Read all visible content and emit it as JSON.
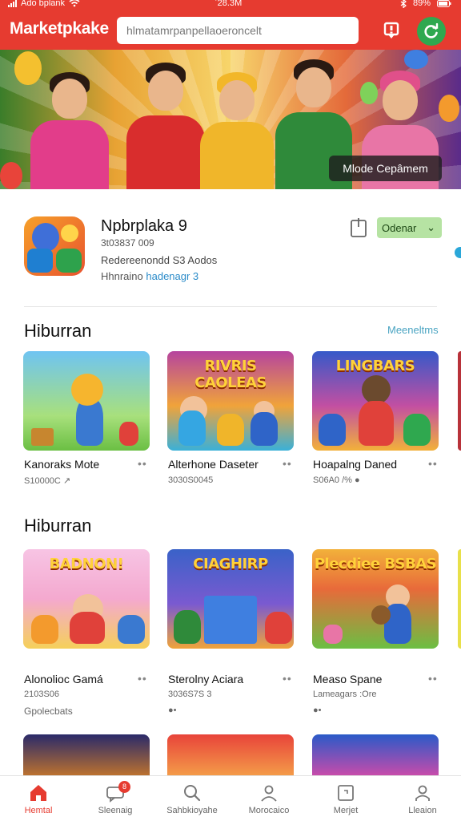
{
  "status_bar": {
    "carrier": "Ado ɓplank",
    "time": "ʾ28.3M",
    "battery": "89%"
  },
  "header": {
    "brand": "Marketpkake",
    "search": {
      "placeholder": "hlmatamrpanpellaoeroncelt",
      "value": ""
    },
    "icons": [
      "notification-icon",
      "refresh-icon"
    ],
    "accent_color": "#e63b30",
    "refresh_color": "#2fa84f"
  },
  "hero": {
    "cta_label": "Mlode Cepâmem"
  },
  "featured_app": {
    "name": "Npbrplaka 9",
    "downloads": "3t03837 009",
    "developer": "Redereenondd S3 Aodos",
    "category_prefix": "Hhnraino ",
    "category_link": "hadenagr 3",
    "open_label": "Odenar",
    "open_chevron": "⌄"
  },
  "sections": [
    {
      "title": "Hiburran",
      "see_all": "Meeneltms",
      "cards": [
        {
          "name": "Kanoraks Mote",
          "meta": "S10000C ↗",
          "art_title": ""
        },
        {
          "name": "Alterhone Daseter",
          "meta": "3030S0045",
          "art_title": "RIVRIS CAOLEAS"
        },
        {
          "name": "Hoapalng Daned",
          "meta": "S06A0 /% ●",
          "art_title": "LINGBARS"
        }
      ]
    },
    {
      "title": "Hiburran",
      "see_all": "",
      "cards": [
        {
          "name": "Alonolioc Gamá",
          "meta": "2103S06",
          "meta2": "Gpolecbats",
          "art_title": "BADNON!"
        },
        {
          "name": "Sterolny Aciara",
          "meta": "3036S7S 3",
          "meta2": "●•",
          "art_title": "CIAGHIRP"
        },
        {
          "name": "Measo Spane",
          "meta": "Lameagars :Ore",
          "meta2": "●•",
          "art_title": "Plecdiee BSBAS"
        }
      ]
    }
  ],
  "bottom_nav": [
    {
      "label": "Hemtal",
      "icon": "home-icon",
      "active": true
    },
    {
      "label": "Sleenaig",
      "icon": "chat-icon",
      "active": false,
      "badge": "8"
    },
    {
      "label": "Sahbkioyahe",
      "icon": "search-icon",
      "active": false
    },
    {
      "label": "Morocaico",
      "icon": "profile-icon",
      "active": false
    },
    {
      "label": "Merjet",
      "icon": "library-icon",
      "active": false
    },
    {
      "label": "Lleaion",
      "icon": "account-icon",
      "active": false
    }
  ]
}
